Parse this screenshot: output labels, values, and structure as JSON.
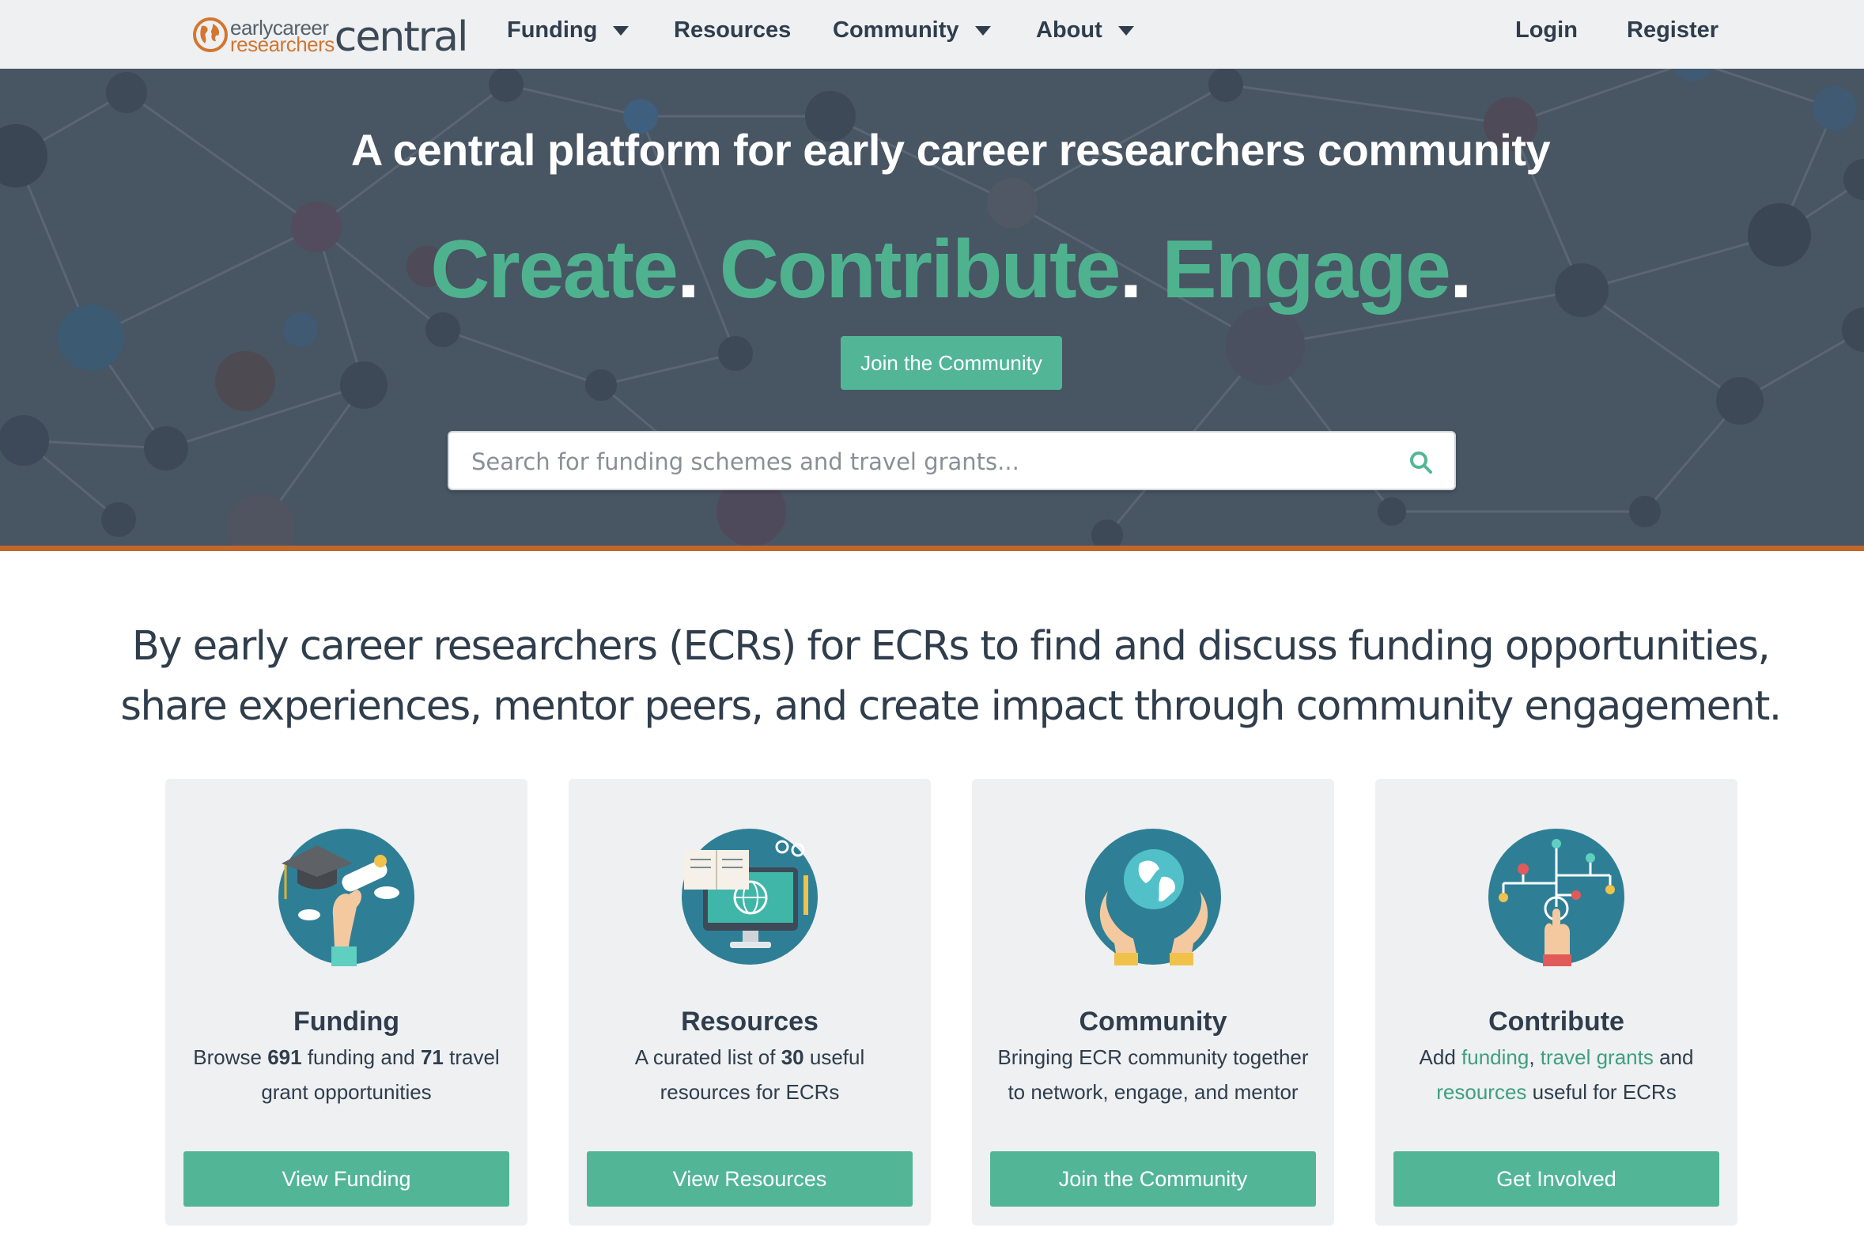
{
  "logo": {
    "line1": "earlycareer",
    "line2": "researchers",
    "word": "central"
  },
  "nav": {
    "items": [
      {
        "label": "Funding"
      },
      {
        "label": "Resources"
      },
      {
        "label": "Community"
      },
      {
        "label": "About"
      }
    ],
    "login": "Login",
    "register": "Register"
  },
  "hero": {
    "title": "A central platform for early career researchers community",
    "tagline": [
      "Create",
      "Contribute",
      "Engage"
    ],
    "dot": ".",
    "button": "Join the Community",
    "search_placeholder": "Search for funding schemes and travel grants..."
  },
  "intro": {
    "line1": "By early career researchers (ECRs) for ECRs to find and discuss funding opportunities,",
    "line2": "share experiences, mentor peers, and create impact through community engagement."
  },
  "cards": [
    {
      "title": "Funding",
      "desc": {
        "p1": "Browse ",
        "n1": "691",
        "p2": " funding and ",
        "n2": "71",
        "p3": " travel grant opportunities"
      },
      "button": "View Funding"
    },
    {
      "title": "Resources",
      "desc": {
        "p1": "A curated list of ",
        "n1": "30",
        "p2": " useful resources for ECRs"
      },
      "button": "View Resources"
    },
    {
      "title": "Community",
      "desc": {
        "text": "Bringing ECR community together to network, engage, and mentor"
      },
      "button": "Join the Community"
    },
    {
      "title": "Contribute",
      "desc": {
        "p1": "Add ",
        "l1": "funding",
        "p2": ", ",
        "l2": "travel grants",
        "p3": " and ",
        "l3": "resources",
        "p4": " useful for ECRs"
      },
      "button": "Get Involved"
    }
  ],
  "colors": {
    "accent": "#52b696",
    "hero_bg": "#485563",
    "orange": "#c0672b",
    "card_bg": "#eef0f2",
    "icon_circle": "#2e7f96"
  },
  "icons": [
    "globe-logo-icon",
    "caret-down-icon",
    "search-icon",
    "graduation-hand-icon",
    "computer-book-icon",
    "hands-globe-icon",
    "network-hand-icon"
  ]
}
